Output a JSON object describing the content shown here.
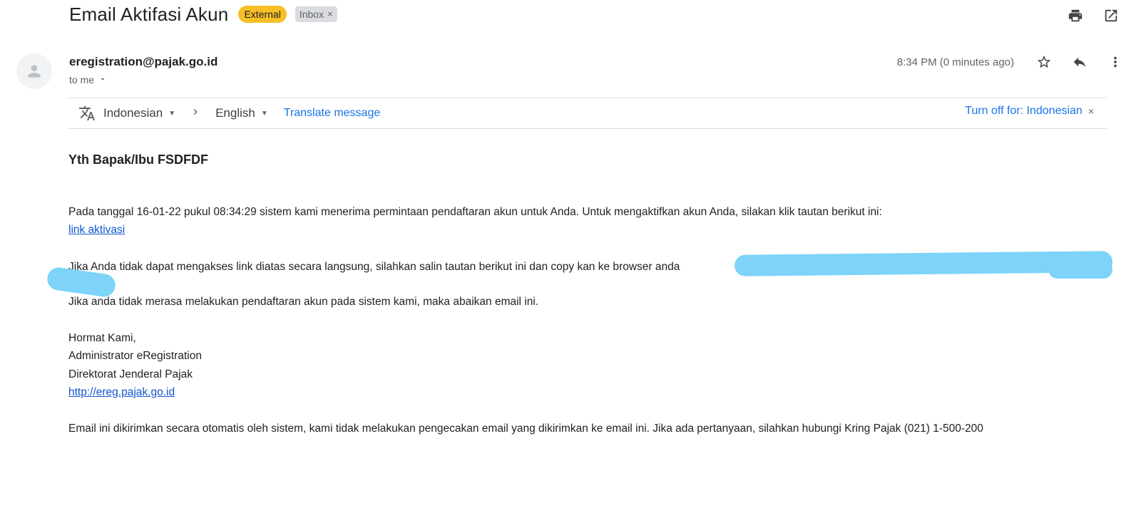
{
  "header": {
    "subject": "Email Aktifasi Akun",
    "label_external": "External",
    "label_inbox": "Inbox",
    "label_inbox_remove": "×",
    "icons": [
      "print-icon",
      "open-in-new-window-icon"
    ]
  },
  "sender": {
    "email": "eregistration@pajak.go.id",
    "to_label": "to me",
    "timestamp": "8:34 PM (0 minutes ago)",
    "icons": [
      "avatar-icon",
      "star-icon",
      "reply-icon",
      "more-vert-icon"
    ]
  },
  "translate": {
    "from_lang": "Indonesian",
    "to_lang": "English",
    "translate_link": "Translate message",
    "turn_off": "Turn off for: Indonesian",
    "turn_off_close": "×"
  },
  "body": {
    "greeting": "Yth Bapak/Ibu FSDFDF",
    "para1": "Pada tanggal 16-01-22 pukul 08:34:29 sistem kami menerima permintaan pendaftaran akun untuk Anda. Untuk mengaktifkan akun Anda, silakan klik tautan berikut ini:",
    "activation_link": "link aktivasi",
    "para2": "Jika Anda tidak dapat mengakses link diatas secara langsung, silahkan salin tautan berikut ini dan copy kan ke browser anda",
    "para3": "Jika anda tidak merasa melakukan pendaftaran akun pada sistem kami, maka abaikan email ini.",
    "sign_1": "Hormat Kami,",
    "sign_2": "Administrator eRegistration",
    "sign_3": "Direktorat Jenderal Pajak",
    "sign_link": "http://ereg.pajak.go.id",
    "footer": "Email ini dikirimkan secara otomatis oleh sistem, kami tidak melakukan pengecakan email yang dikirimkan ke email ini. Jika ada pertanyaan, silahkan hubungi Kring Pajak (021) 1-500-200"
  },
  "colors": {
    "external_tag": "#f6bf26",
    "link": "#1155cc",
    "translate_link": "#1a73e8",
    "redaction": "#7dd3f8"
  }
}
